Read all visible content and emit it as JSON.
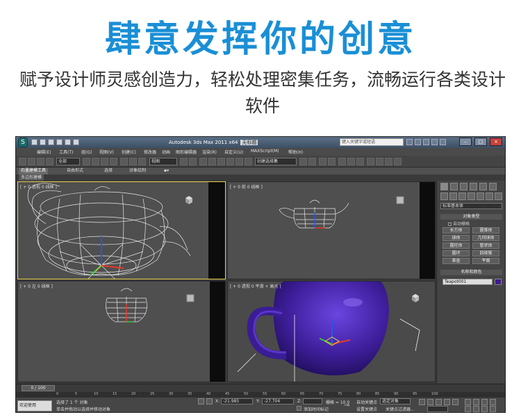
{
  "headline": "肆意发挥你的创意",
  "subline": "赋予设计师灵感创造力，轻松处理密集任务，流畅运行各类设计软件",
  "app": {
    "window_title": "Autodesk 3ds Max  2011 x64",
    "window_title_extra": "无标题",
    "search_placeholder": "键入关键字或短语",
    "menu": [
      "编辑(E)",
      "工具(T)",
      "组(G)",
      "视图(V)",
      "创建(C)",
      "修改器",
      "动画",
      "图形编辑器",
      "渲染(R)",
      "自定义(U)",
      "MAXScript(M)",
      "帮助(H)"
    ],
    "toolbar": {
      "selection_filter": "全部",
      "view_dropdown": "视图",
      "named_selection": "创建选择集"
    },
    "ribbon_tabs": [
      "石墨建模工具",
      "自由形式",
      "选择",
      "对象绘制"
    ],
    "subtab": "多边形建模",
    "viewports": {
      "top": "[ + 0 透视 0 线框 ]",
      "front": "[ + 0 前 0 线框 ]",
      "left": "[ + 0 左 0 线框 ]",
      "persp": "[ + 0 透视 0 平滑 + 高光 ]"
    },
    "command_panel": {
      "dropdown": "标准基本体",
      "object_type_title": "对象类型",
      "autogrid": "自动栅格",
      "buttons": [
        "长方体",
        "圆锥体",
        "球体",
        "几何球体",
        "圆柱体",
        "管状体",
        "圆环",
        "四棱锥",
        "茶壶",
        "平面"
      ],
      "name_color_title": "名称和颜色",
      "object_name": "Teapot001",
      "object_color": "#3f1a8f"
    },
    "timeline": {
      "frame_counter": "0 / 100",
      "ticks": [
        "0",
        "5",
        "10",
        "15",
        "20",
        "25",
        "30",
        "35",
        "40",
        "45",
        "50",
        "55",
        "60",
        "65",
        "70",
        "75",
        "80",
        "85",
        "90",
        "95",
        "100"
      ]
    },
    "status": {
      "welcome": "欢迎使用 MAXSc",
      "selected": "选择了 1 个 对象",
      "hint": "单击并拖动以选择并移动对象",
      "x_label": "X:",
      "x_value": "-21.985",
      "y_label": "Y:",
      "y_value": "-27.704",
      "z_label": "Z:",
      "grid": "栅格 = 10.0",
      "add_time_tag": "添加时间标记",
      "auto_key": "自动关键点",
      "set_key": "设置关键点",
      "key_filter_sel": "选定对象",
      "key_filters": "关键点过滤器..."
    }
  }
}
